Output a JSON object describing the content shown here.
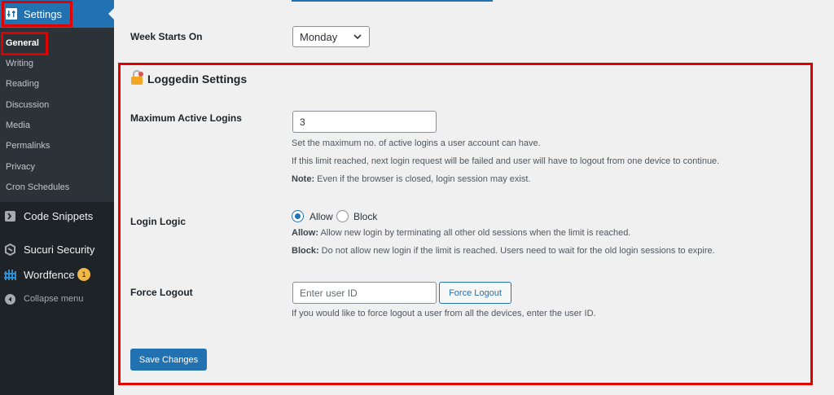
{
  "sidebar": {
    "settings_label": "Settings",
    "submenu": [
      {
        "label": "General",
        "current": true
      },
      {
        "label": "Writing"
      },
      {
        "label": "Reading"
      },
      {
        "label": "Discussion"
      },
      {
        "label": "Media"
      },
      {
        "label": "Permalinks"
      },
      {
        "label": "Privacy"
      },
      {
        "label": "Cron Schedules"
      }
    ],
    "menu": [
      {
        "label": "Code Snippets",
        "icon": "code-snippets-icon"
      },
      {
        "label": "Sucuri Security",
        "icon": "sucuri-icon"
      },
      {
        "label": "Wordfence",
        "icon": "wordfence-icon",
        "badge": "1"
      },
      {
        "label": "Collapse menu",
        "icon": "collapse-icon"
      }
    ],
    "colors": {
      "bg": "#1d2327",
      "active": "#2271b1",
      "highlight": "#e10000"
    }
  },
  "week_starts_on": {
    "label": "Week Starts On",
    "value": "Monday"
  },
  "loggedin": {
    "title": "Loggedin Settings",
    "max_logins": {
      "label": "Maximum Active Logins",
      "value": "3",
      "desc1": "Set the maximum no. of active logins a user account can have.",
      "desc2": "If this limit reached, next login request will be failed and user will have to logout from one device to continue.",
      "note_label": "Note:",
      "note_text": " Even if the browser is closed, login session may exist."
    },
    "login_logic": {
      "label": "Login Logic",
      "options": [
        "Allow",
        "Block"
      ],
      "selected": "Allow",
      "allow_label": "Allow:",
      "allow_text": " Allow new login by terminating all other old sessions when the limit is reached.",
      "block_label": "Block:",
      "block_text": " Do not allow new login if the limit is reached. Users need to wait for the old login sessions to expire."
    },
    "force_logout": {
      "label": "Force Logout",
      "placeholder": "Enter user ID",
      "button": "Force Logout",
      "desc": "If you would like to force logout a user from all the devices, enter the user ID."
    },
    "save_button": "Save Changes"
  }
}
